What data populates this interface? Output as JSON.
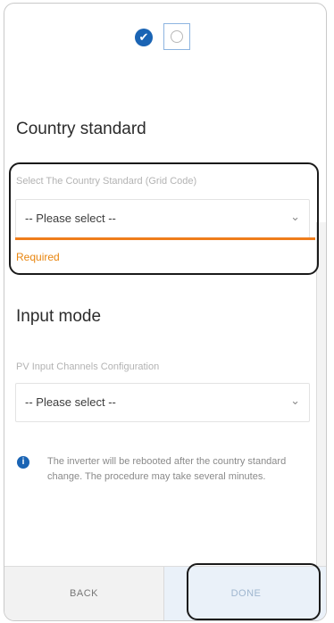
{
  "steps": {
    "completed_icon": "check-icon",
    "pending_icon": "circle-icon"
  },
  "country": {
    "title": "Country standard",
    "label": "Select The Country Standard (Grid Code)",
    "select_value": "-- Please select --",
    "error": "Required"
  },
  "input_mode": {
    "title": "Input mode",
    "label": "PV Input Channels Configuration",
    "select_value": "-- Please select --"
  },
  "info": {
    "text": "The inverter will be rebooted after the country standard change. The procedure may take several minutes."
  },
  "footer": {
    "back_label": "BACK",
    "done_label": "DONE"
  },
  "colors": {
    "accent": "#1a64b4",
    "error": "#ef7d1b"
  }
}
